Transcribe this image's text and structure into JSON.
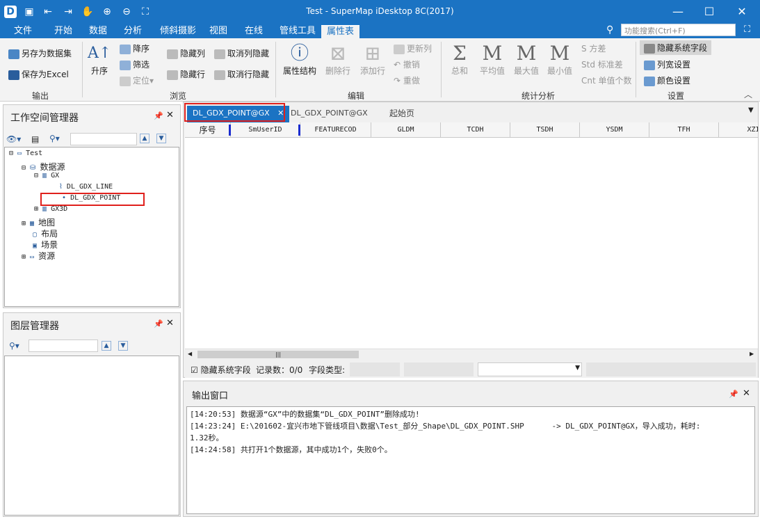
{
  "window": {
    "title": "Test - SuperMap iDesktop 8C(2017)"
  },
  "menu": {
    "tabs": [
      "文件",
      "开始",
      "数据",
      "分析",
      "倾斜摄影",
      "视图",
      "在线",
      "管线工具",
      "属性表"
    ],
    "search_placeholder": "功能搜索(Ctrl+F)"
  },
  "ribbon": {
    "output": {
      "save_dataset": "另存为数据集",
      "save_excel": "保存为Excel",
      "label": "输出"
    },
    "browse": {
      "asc": "升序",
      "desc": "降序",
      "filter": "筛选",
      "locate": "定位",
      "hide_col": "隐藏列",
      "unhide_col": "取消列隐藏",
      "hide_row": "隐藏行",
      "unhide_row": "取消行隐藏",
      "label": "浏览"
    },
    "edit": {
      "attr_struct": "属性结构",
      "del_col": "删除行",
      "add_row": "添加行",
      "update_col": "更新列",
      "undo": "撤销",
      "redo": "重做",
      "label": "编辑"
    },
    "stats": {
      "sum": "总和",
      "avg": "平均值",
      "max": "最大值",
      "min": "最小值",
      "variance": "方差",
      "stddev": "标准差",
      "unique": "单值个数",
      "label": "统计分析"
    },
    "settings": {
      "hide_sys": "隐藏系统字段",
      "col_width": "列宽设置",
      "color": "颜色设置",
      "label": "设置"
    }
  },
  "workspace": {
    "title": "工作空间管理器",
    "tree": {
      "root": "Test",
      "datasource": "数据源",
      "gx": "GX",
      "line": "DL_GDX_LINE",
      "point": "DL_GDX_POINT",
      "gx3d": "GX3D",
      "map": "地图",
      "layout": "布局",
      "scene": "场景",
      "resource": "资源"
    }
  },
  "layers": {
    "title": "图层管理器"
  },
  "doc_tabs": [
    "DL_GDX_POINT@GX",
    "DL_GDX_POINT@GX",
    "起始页"
  ],
  "grid": {
    "columns": [
      "序号",
      "SmUserID",
      "FEATURECOD",
      "GLDM",
      "TCDH",
      "TSDH",
      "YSDM",
      "TFH",
      "XZI"
    ]
  },
  "status": {
    "hide_sys": "隐藏系统字段",
    "records": "记录数：0/0",
    "field_type": "字段类型:"
  },
  "output": {
    "title": "输出窗口",
    "lines": [
      "[14:20:53] 数据源“GX”中的数据集“DL_GDX_POINT”删除成功!",
      "[14:23:24] E:\\201602-宜兴市地下管线项目\\数据\\Test_部分_Shape\\DL_GDX_POINT.SHP      -> DL_GDX_POINT@GX，导入成功，耗时:",
      "1.32秒。",
      "[14:24:58] 共打开1个数据源，其中成功1个，失败0个。"
    ]
  }
}
